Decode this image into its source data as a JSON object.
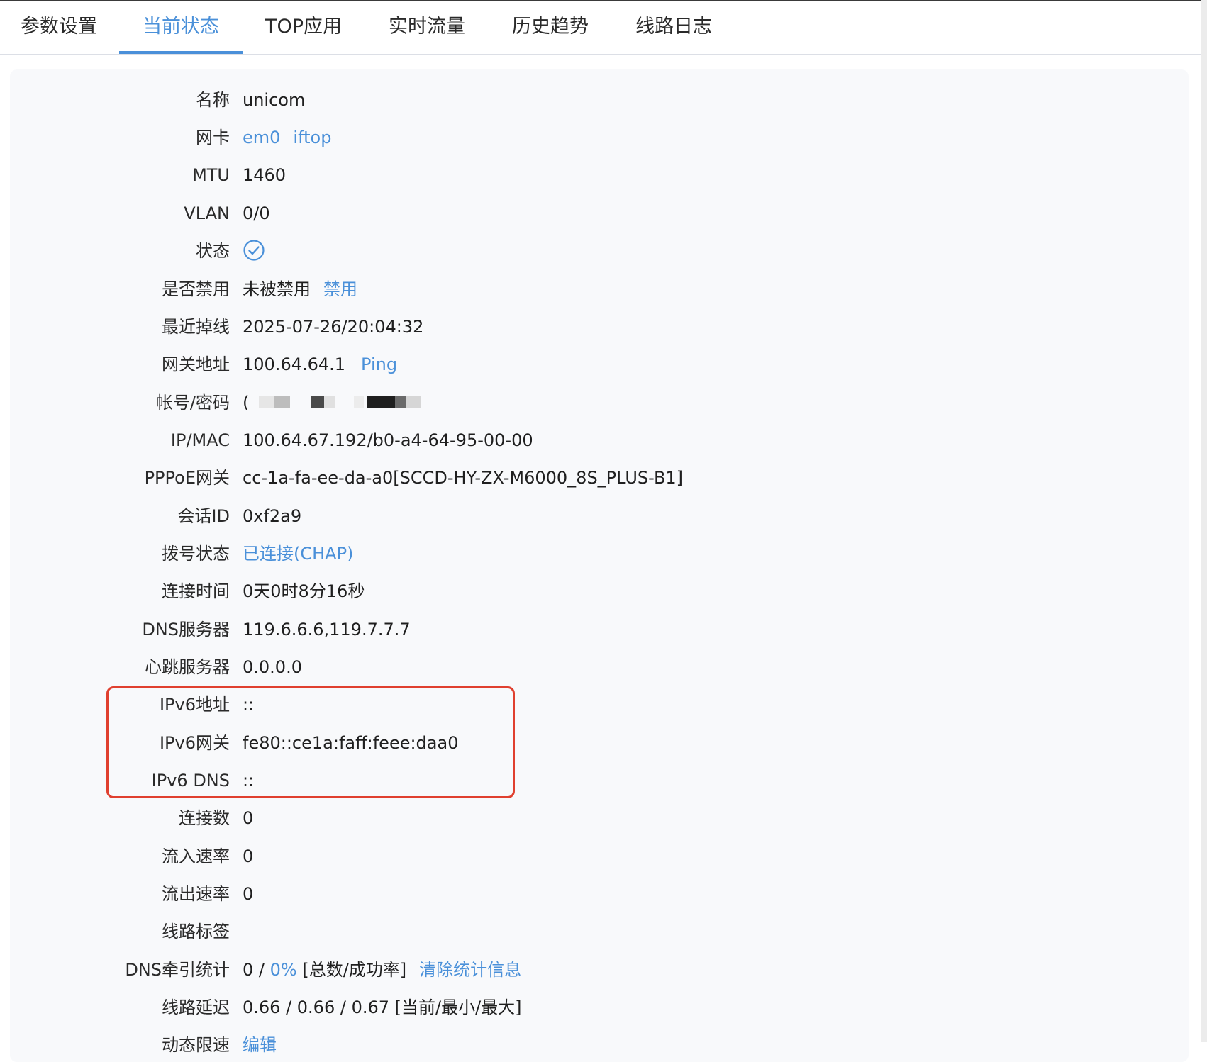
{
  "tabs": [
    {
      "label": "参数设置",
      "active": false
    },
    {
      "label": "当前状态",
      "active": true
    },
    {
      "label": "TOP应用",
      "active": false
    },
    {
      "label": "实时流量",
      "active": false
    },
    {
      "label": "历史趋势",
      "active": false
    },
    {
      "label": "线路日志",
      "active": false
    }
  ],
  "colors": {
    "accent": "#4a90d9",
    "highlight_border": "#e0402f",
    "panel_bg": "#f8f9fb"
  },
  "fields": {
    "name": {
      "label": "名称",
      "value": "unicom"
    },
    "nic": {
      "label": "网卡",
      "link1": "em0",
      "link2": "iftop"
    },
    "mtu": {
      "label": "MTU",
      "value": "1460"
    },
    "vlan": {
      "label": "VLAN",
      "value": "0/0"
    },
    "status": {
      "label": "状态",
      "icon": "check-circle-icon"
    },
    "disabled": {
      "label": "是否禁用",
      "value": "未被禁用",
      "action": "禁用"
    },
    "last_drop": {
      "label": "最近掉线",
      "value": "2025-07-26/20:04:32"
    },
    "gateway": {
      "label": "网关地址",
      "value": "100.64.64.1",
      "action": "Ping"
    },
    "account": {
      "label": "帐号/密码",
      "value": "("
    },
    "ip_mac": {
      "label": "IP/MAC",
      "value": "100.64.67.192/b0-a4-64-95-00-00"
    },
    "pppoe_gw": {
      "label": "PPPoE网关",
      "value": "cc-1a-fa-ee-da-a0[SCCD-HY-ZX-M6000_8S_PLUS-B1]"
    },
    "session_id": {
      "label": "会话ID",
      "value": "0xf2a9"
    },
    "dial_status": {
      "label": "拨号状态",
      "value": "已连接(CHAP)"
    },
    "conn_time": {
      "label": "连接时间",
      "value": "0天0时8分16秒"
    },
    "dns": {
      "label": "DNS服务器",
      "value": "119.6.6.6,119.7.7.7"
    },
    "heartbeat": {
      "label": "心跳服务器",
      "value": "0.0.0.0"
    },
    "ipv6_addr": {
      "label": "IPv6地址",
      "value": "::"
    },
    "ipv6_gw": {
      "label": "IPv6网关",
      "value": "fe80::ce1a:faff:feee:daa0"
    },
    "ipv6_dns": {
      "label": "IPv6 DNS",
      "value": "::"
    },
    "conn_count": {
      "label": "连接数",
      "value": "0"
    },
    "in_rate": {
      "label": "流入速率",
      "value": "0"
    },
    "out_rate": {
      "label": "流出速率",
      "value": "0"
    },
    "line_tag": {
      "label": "线路标签",
      "value": ""
    },
    "dns_stats": {
      "label": "DNS牵引统计",
      "count": "0 /",
      "rate": "0%",
      "suffix": "[总数/成功率]",
      "action": "清除统计信息"
    },
    "latency": {
      "label": "线路延迟",
      "value": "0.66 / 0.66 / 0.67 [当前/最小/最大]"
    },
    "dyn_limit": {
      "label": "动态限速",
      "action": "编辑"
    }
  }
}
